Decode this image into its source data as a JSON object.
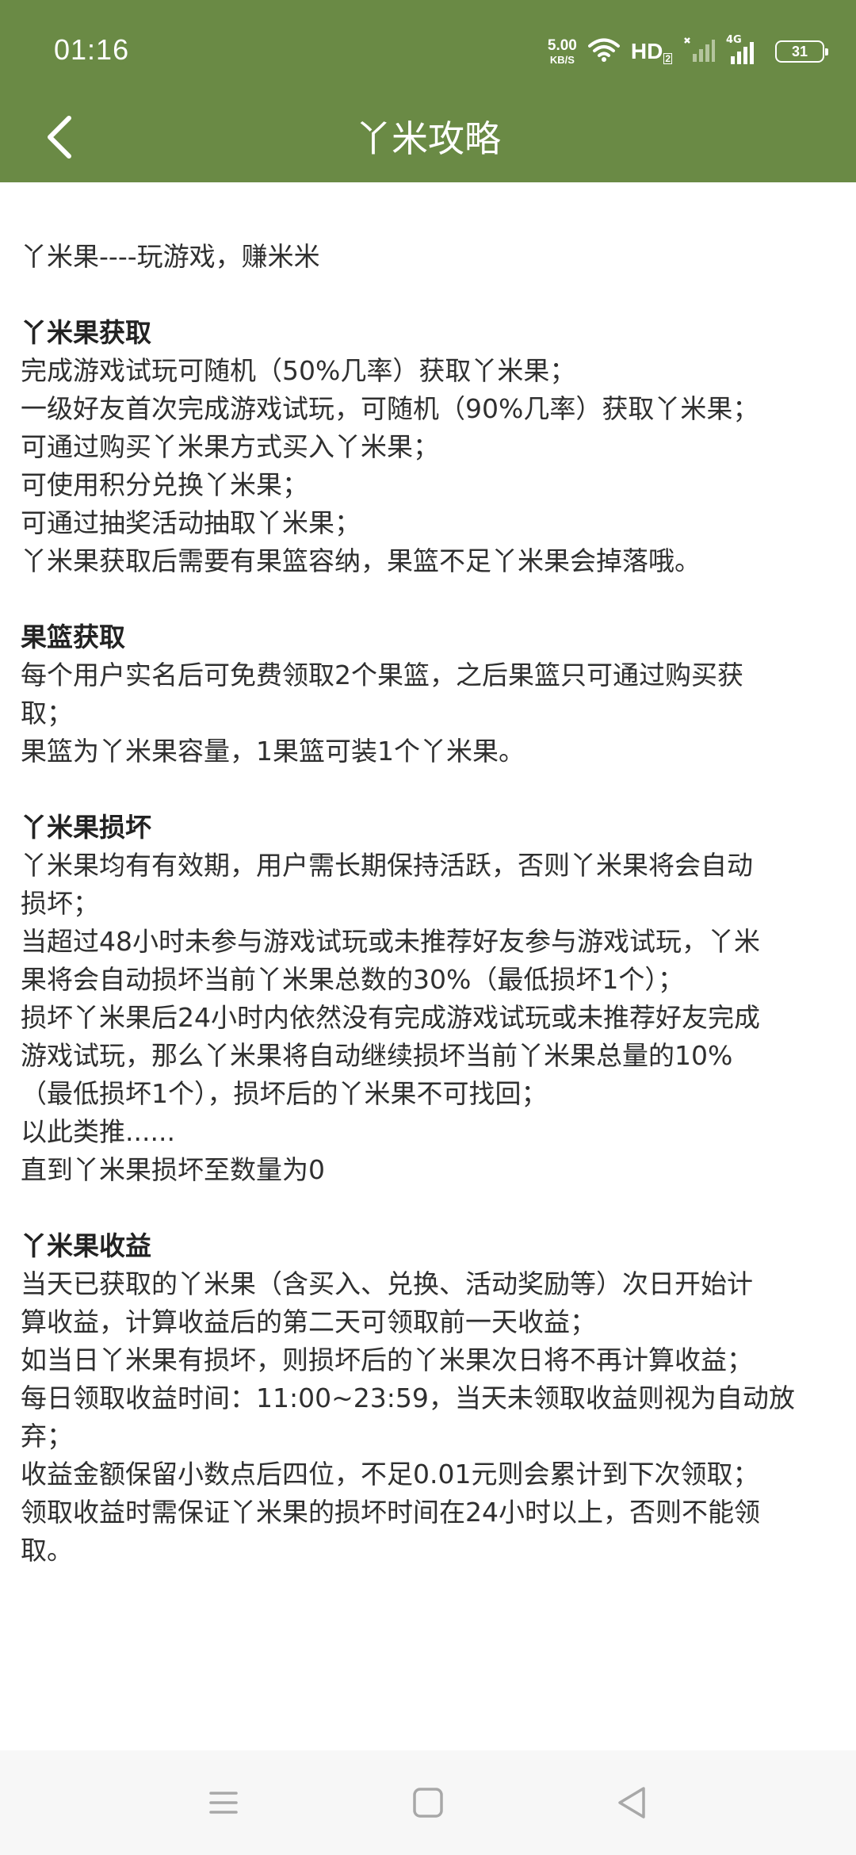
{
  "status_bar": {
    "time": "01:16",
    "net_speed_value": "5.00",
    "net_speed_unit": "KB/S",
    "hd_label": "HD",
    "hd_sub": "2",
    "network_tag": "4G",
    "battery": "31"
  },
  "toolbar": {
    "title": "丫米攻略"
  },
  "content": {
    "lines": [
      {
        "text": "丫米果----玩游戏，赚米米",
        "heading": false
      },
      {
        "text": "",
        "heading": false
      },
      {
        "text": "丫米果获取",
        "heading": true
      },
      {
        "text": "完成游戏试玩可随机（50%几率）获取丫米果；",
        "heading": false
      },
      {
        "text": "一级好友首次完成游戏试玩，可随机（90%几率）获取丫米果；",
        "heading": false
      },
      {
        "text": "可通过购买丫米果方式买入丫米果；",
        "heading": false
      },
      {
        "text": "可使用积分兑换丫米果；",
        "heading": false
      },
      {
        "text": "可通过抽奖活动抽取丫米果；",
        "heading": false
      },
      {
        "text": "丫米果获取后需要有果篮容纳，果篮不足丫米果会掉落哦。",
        "heading": false
      },
      {
        "text": "",
        "heading": false
      },
      {
        "text": "果篮获取",
        "heading": true
      },
      {
        "text": "每个用户实名后可免费领取2个果篮，之后果篮只可通过购买获",
        "heading": false
      },
      {
        "text": "取；",
        "heading": false
      },
      {
        "text": "果篮为丫米果容量，1果篮可装1个丫米果。",
        "heading": false
      },
      {
        "text": "",
        "heading": false
      },
      {
        "text": "丫米果损坏",
        "heading": true
      },
      {
        "text": "丫米果均有有效期，用户需长期保持活跃，否则丫米果将会自动",
        "heading": false
      },
      {
        "text": "损坏；",
        "heading": false
      },
      {
        "text": "当超过48小时未参与游戏试玩或未推荐好友参与游戏试玩，丫米",
        "heading": false
      },
      {
        "text": "果将会自动损坏当前丫米果总数的30%（最低损坏1个）；",
        "heading": false
      },
      {
        "text": "损坏丫米果后24小时内依然没有完成游戏试玩或未推荐好友完成",
        "heading": false
      },
      {
        "text": "游戏试玩，那么丫米果将自动继续损坏当前丫米果总量的10%",
        "heading": false
      },
      {
        "text": "（最低损坏1个），损坏后的丫米果不可找回；",
        "heading": false
      },
      {
        "text": "以此类推......",
        "heading": false
      },
      {
        "text": "直到丫米果损坏至数量为0",
        "heading": false
      },
      {
        "text": "",
        "heading": false
      },
      {
        "text": "丫米果收益",
        "heading": true
      },
      {
        "text": "当天已获取的丫米果（含买入、兑换、活动奖励等）次日开始计",
        "heading": false
      },
      {
        "text": "算收益，计算收益后的第二天可领取前一天收益；",
        "heading": false
      },
      {
        "text": "如当日丫米果有损坏，则损坏后的丫米果次日将不再计算收益；",
        "heading": false
      },
      {
        "text": "每日领取收益时间：11:00~23:59，当天未领取收益则视为自动放",
        "heading": false
      },
      {
        "text": "弃；",
        "heading": false
      },
      {
        "text": "收益金额保留小数点后四位，不足0.01元则会累计到下次领取；",
        "heading": false
      },
      {
        "text": "领取收益时需保证丫米果的损坏时间在24小时以上，否则不能领",
        "heading": false
      },
      {
        "text": "取。",
        "heading": false
      }
    ]
  },
  "colors": {
    "header": "#6a8a45",
    "text": "#2f2f2f",
    "nav_bar": "#f7f7f7",
    "nav_icon": "#a8a8a8"
  },
  "icons": [
    "back-arrow-icon",
    "wifi-icon",
    "signal-icon",
    "battery-icon",
    "menu-icon",
    "home-icon",
    "back-triangle-icon"
  ]
}
